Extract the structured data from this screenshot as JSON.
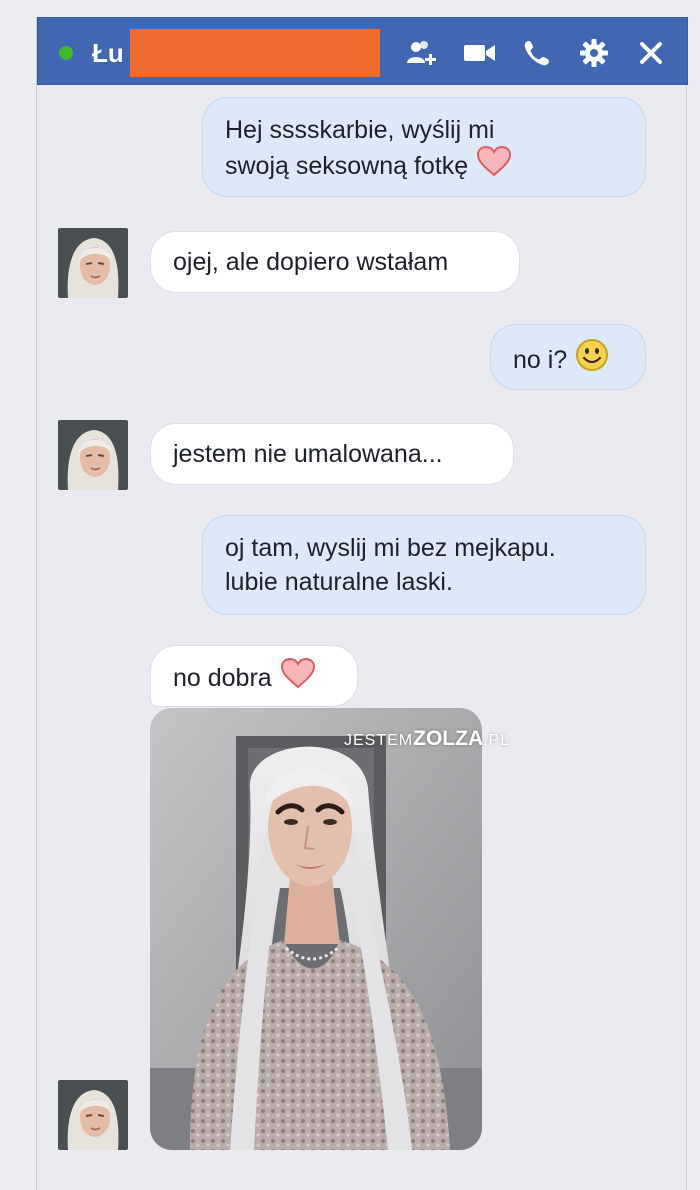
{
  "header": {
    "contact_name": "Łu",
    "status": "online",
    "status_color": "#42b72a",
    "bar_color": "#4267b2",
    "redaction_color": "#f26a2e",
    "icons": [
      "add-people-icon",
      "video-call-icon",
      "phone-call-icon",
      "gear-icon",
      "close-icon"
    ]
  },
  "messages": [
    {
      "from": "me",
      "lines": [
        "Hej sssskarbie, wyślij mi",
        "swoją seksowną fotkę"
      ],
      "emoji": "heart-icon"
    },
    {
      "from": "contact",
      "lines": [
        "ojej, ale dopiero wstałam"
      ]
    },
    {
      "from": "me",
      "lines": [
        "no i?"
      ],
      "emoji": "smiley-icon"
    },
    {
      "from": "contact",
      "lines": [
        "jestem nie umalowana..."
      ]
    },
    {
      "from": "me",
      "lines": [
        "oj tam, wyslij mi bez mejkapu.",
        "lubie naturalne laski."
      ]
    },
    {
      "from": "contact",
      "lines": [
        "no dobra"
      ],
      "emoji": "heart-icon"
    },
    {
      "from": "contact",
      "attachment": "photo"
    }
  ],
  "watermark": {
    "prefix": "JESTEM",
    "brand": "ZOLZA",
    "suffix": ".PL"
  }
}
